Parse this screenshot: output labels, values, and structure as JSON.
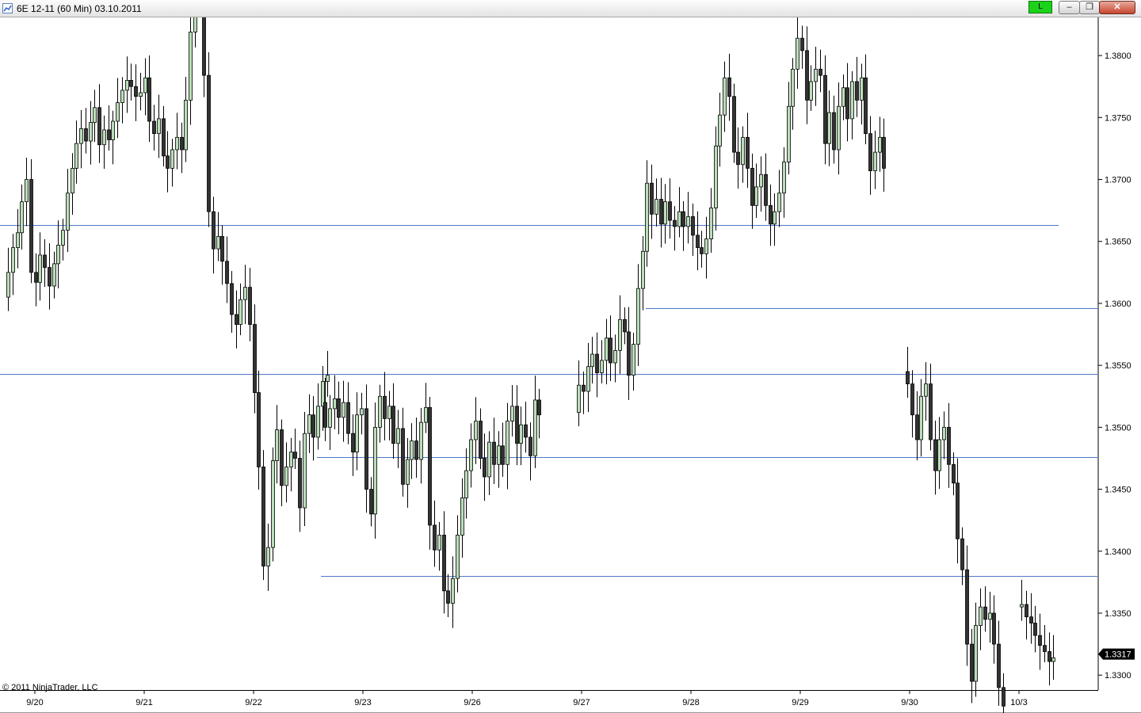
{
  "window": {
    "title": "6E 12-11 (60 Min)  03.10.2011",
    "indicator_label": "L",
    "indicator_color": "#1bd21b"
  },
  "copyright": "© 2011 NinjaTrader, LLC",
  "colors": {
    "up_fill": "#b9dfb9",
    "down_fill": "#333333",
    "line": "#4f79c7",
    "axis": "#000000"
  },
  "chart_data": {
    "type": "candlestick",
    "y_ticks": [
      "1.3800",
      "1.3750",
      "1.3700",
      "1.3650",
      "1.3600",
      "1.3550",
      "1.3500",
      "1.3450",
      "1.3400",
      "1.3350",
      "1.3300"
    ],
    "y_range": [
      1.3295,
      1.3825
    ],
    "x_labels": [
      "9/20",
      "9/21",
      "9/22",
      "9/23",
      "9/26",
      "9/27",
      "9/28",
      "9/29",
      "9/30",
      "10/3"
    ],
    "last_price": "1.3317",
    "horizontal_lines": [
      {
        "price": 1.3663,
        "from": 0,
        "to": 1336
      },
      {
        "price": 1.3596,
        "from": 815,
        "to": 1386
      },
      {
        "price": 1.3543,
        "from": 0,
        "to": 1386
      },
      {
        "price": 1.3476,
        "from": 400,
        "to": 1386
      },
      {
        "price": 1.338,
        "from": 405,
        "to": 1386
      }
    ],
    "series": [
      {
        "segment": "9/20",
        "start": 1.3605,
        "values": [
          0.002,
          0.002,
          0.0012,
          0.0025,
          0.0018,
          -0.0075,
          -0.0008,
          0.0022,
          -0.001,
          -0.0015,
          0.0018,
          0.0015,
          0.0012,
          0.003,
          0.002,
          0.002,
          0.0012,
          -0.001,
          0.0015,
          0.0012,
          -0.003,
          0.0012,
          -0.0008,
          0.0015,
          0.0015,
          0.001,
          0.0008,
          -0.0005,
          -0.0008,
          0.0003,
          0.0012,
          -0.0035,
          -0.001,
          0.0012,
          -0.003,
          -0.001,
          0.0015,
          0.001,
          -0.001,
          0.004,
          0.0055,
          0.0045,
          0.0045,
          -0.0125,
          -0.011,
          -0.003,
          0.001,
          -0.002,
          -0.0018,
          -0.0025,
          -0.0008,
          0.002,
          0.001,
          -0.003,
          -0.0055,
          -0.006,
          -0.008,
          0.0015,
          0.007,
          0.0025,
          -0.0045,
          0.0015,
          0.0012,
          -0.0005,
          -0.004,
          0.006,
          0.0015,
          -0.0018,
          0.0025,
          0.002,
          0.0005
        ]
      },
      {
        "segment": "9/23",
        "start": 1.352,
        "values": [
          -0.002,
          0.0015,
          0.0008,
          -0.0015,
          0.0012,
          -0.0025,
          -0.0015,
          0.003,
          0.0005,
          -0.0065,
          -0.002,
          0.007,
          0.0025,
          -0.0018,
          0.001,
          -0.003,
          0.0012,
          -0.0045,
          0.002,
          0.0015,
          -0.0015,
          0.003,
          0.0012,
          -0.0095,
          -0.002,
          0.0012,
          -0.0045,
          -0.001,
          0.002,
          0.0035,
          0.003,
          0.0022,
          0.0025,
          0.0015,
          -0.003,
          -0.0015,
          0.0028,
          -0.0018,
          0.0015,
          -0.0015,
          0.0035,
          0.0012,
          -0.003,
          0.0015,
          -0.001,
          -0.0015,
          0.0045,
          -0.0012
        ]
      },
      {
        "segment": "9/27",
        "start": 1.3512,
        "values": [
          0.0022,
          -0.0005,
          0.002,
          0.001,
          -0.0015,
          0.001,
          0.0018,
          -0.002,
          0.001,
          0.0025,
          -0.001,
          -0.0035,
          0.0025,
          0.0045,
          0.003,
          0.0055,
          -0.0025,
          0.0012,
          -0.002,
          0.0018,
          -0.0015,
          -0.0005,
          0.0012,
          -0.0012,
          0.0008,
          -0.0015,
          -0.001,
          -0.0005,
          0.0012,
          0.0025,
          0.005,
          0.0025,
          0.003,
          -0.0015,
          -0.0045,
          -0.001,
          0.0022,
          -0.0025,
          -0.003,
          0.0015,
          0.001,
          -0.0025,
          -0.0015,
          0.001,
          0.0015,
          0.0025,
          0.0045,
          0.003,
          0.0025,
          -0.001,
          -0.004,
          0.0015,
          0.001,
          -0.0005,
          -0.0055,
          0.0025,
          -0.003,
          0.0035,
          0.0015,
          -0.0025,
          0.003,
          -0.0015,
          0.0018,
          -0.0045,
          -0.003,
          0.0015,
          0.0012,
          -0.0025
        ]
      },
      {
        "segment": "9/30",
        "start": 1.3545,
        "values": [
          -0.001,
          -0.0025,
          -0.002,
          0.0035,
          0.001,
          -0.0045,
          -0.0025,
          0.0025,
          0.001,
          -0.003,
          -0.0015,
          -0.0045,
          -0.0025,
          -0.006,
          -0.003,
          0.0045,
          0.0015,
          -0.001,
          0.0005,
          -0.0025,
          -0.0035,
          -0.0015
        ]
      },
      {
        "segment": "10/3",
        "start": 1.3355,
        "values": [
          0.0002,
          -0.001,
          -0.0005,
          -0.001,
          -0.0008,
          -0.0005,
          -0.0008,
          0.0003
        ]
      }
    ]
  }
}
